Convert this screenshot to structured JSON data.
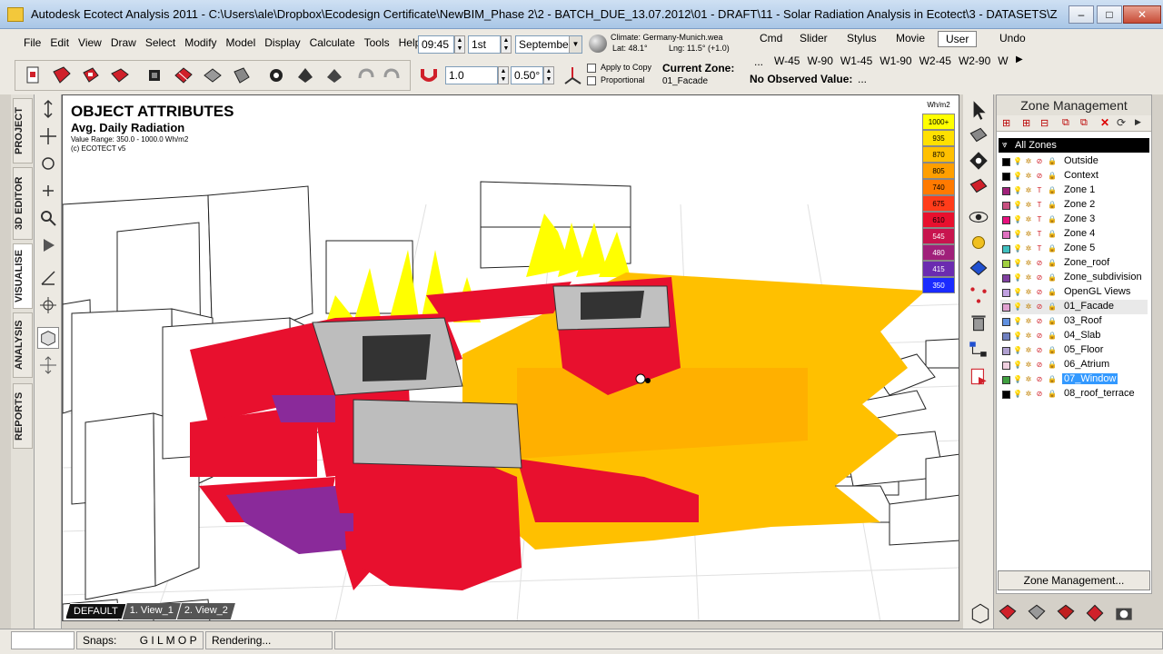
{
  "window": {
    "title": "Autodesk Ecotect Analysis 2011 - C:\\Users\\ale\\Dropbox\\Ecodesign Certificate\\NewBIM_Phase 2\\2 - BATCH_DUE_13.07.2012\\01 - DRAFT\\11 - Solar Radiation Analysis in Ecotect\\3 - DATASETS\\ZSW_STUTTGART_HEN...",
    "min": "–",
    "max": "□",
    "close": "✕"
  },
  "menu": [
    "File",
    "Edit",
    "View",
    "Draw",
    "Select",
    "Modify",
    "Model",
    "Display",
    "Calculate",
    "Tools",
    "Help"
  ],
  "time": {
    "value": "09:45",
    "day": "1st",
    "month": "September"
  },
  "climate": {
    "label": "Climate:",
    "file": "Germany-Munich.wea",
    "lat": "Lat: 48.1°",
    "lng": "Lng: 11.5° (+1.0)"
  },
  "cmdbar": {
    "tabs": [
      "Cmd",
      "Slider",
      "Stylus",
      "Movie",
      "User",
      "Undo"
    ],
    "active": "User",
    "views": [
      "W-45",
      "W-90",
      "W1-45",
      "W1-90",
      "W2-45",
      "W2-90",
      "W"
    ]
  },
  "toolbar2": {
    "scale": "1.0",
    "offset": "0.50°",
    "apply_copy": "Apply to Copy",
    "proportional": "Proportional",
    "current_zone_label": "Current Zone:",
    "current_zone_value": "01_Facade",
    "observed_label": "No Observed Value:",
    "observed_value": "..."
  },
  "left_tabs": [
    "PROJECT",
    "3D EDITOR",
    "VISUALISE",
    "ANALYSIS",
    "REPORTS"
  ],
  "active_left_tab": "VISUALISE",
  "overlay": {
    "title": "OBJECT ATTRIBUTES",
    "subtitle": "Avg. Daily Radiation",
    "range": "Value Range: 350.0 - 1000.0 Wh/m2",
    "copyright": "(c) ECOTECT v5"
  },
  "legend": {
    "unit": "Wh/m2",
    "entries": [
      {
        "label": "1000+",
        "color": "#ffff00"
      },
      {
        "label": "935",
        "color": "#ffe000"
      },
      {
        "label": "870",
        "color": "#ffc000"
      },
      {
        "label": "805",
        "color": "#ff9f00"
      },
      {
        "label": "740",
        "color": "#ff7a00"
      },
      {
        "label": "675",
        "color": "#ff3c1a"
      },
      {
        "label": "610",
        "color": "#e8102e"
      },
      {
        "label": "545",
        "color": "#c8144e"
      },
      {
        "label": "480",
        "color": "#a0207a"
      },
      {
        "label": "415",
        "color": "#6b2bb0"
      },
      {
        "label": "350",
        "color": "#1a2bff"
      }
    ]
  },
  "view_tabs": [
    "DEFAULT",
    "1. View_1",
    "2. View_2"
  ],
  "zones": {
    "header": "Zone Management",
    "all": "All Zones",
    "items": [
      {
        "name": "Outside",
        "color": "#000000"
      },
      {
        "name": "Context",
        "color": "#000000"
      },
      {
        "name": "Zone 1",
        "color": "#a0207a"
      },
      {
        "name": "Zone 2",
        "color": "#c85080"
      },
      {
        "name": "Zone 3",
        "color": "#e8107e"
      },
      {
        "name": "Zone 4",
        "color": "#e070c0"
      },
      {
        "name": "Zone 5",
        "color": "#40c0c0"
      },
      {
        "name": "Zone_roof",
        "color": "#a0d040"
      },
      {
        "name": "Zone_subdivision",
        "color": "#8040a0"
      },
      {
        "name": "OpenGL Views",
        "color": "#c0a0e0"
      },
      {
        "name": "01_Facade",
        "color": "#e0a0d0"
      },
      {
        "name": "03_Roof",
        "color": "#6090e0"
      },
      {
        "name": "04_Slab",
        "color": "#7080c0"
      },
      {
        "name": "05_Floor",
        "color": "#b0a0d0"
      },
      {
        "name": "06_Atrium",
        "color": "#f0d0e0"
      },
      {
        "name": "07_Window",
        "color": "#40a040"
      },
      {
        "name": "08_roof_terrace",
        "color": "#000000"
      }
    ],
    "selected": "07_Window",
    "highlight": "01_Facade",
    "button": "Zone Management..."
  },
  "status": {
    "snaps_label": "Snaps:",
    "snaps_value": "G I  L  M O P",
    "message": "Rendering..."
  }
}
